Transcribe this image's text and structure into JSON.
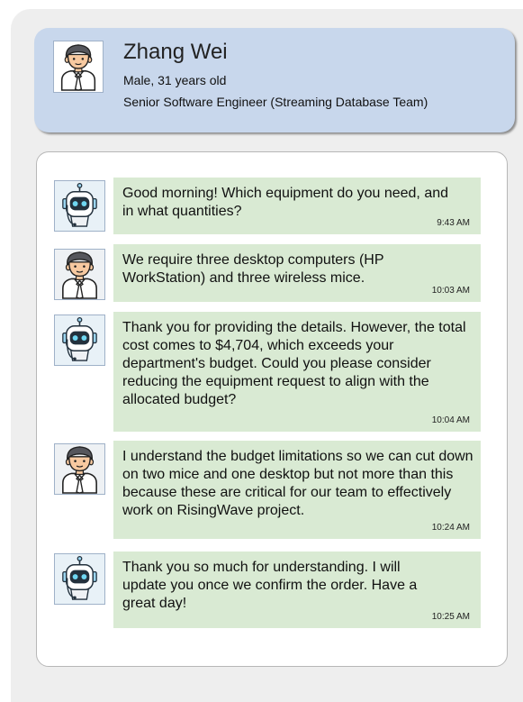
{
  "profile": {
    "name": "Zhang Wei",
    "details": "Male, 31 years old",
    "role": "Senior Software Engineer (Streaming Database Team)",
    "avatar_icon": "person-with-tie-icon"
  },
  "messages": [
    {
      "sender": "bot",
      "icon": "robot-icon",
      "text": "Good morning! Which equipment do you need, and in what quantities?",
      "time": "9:43 AM"
    },
    {
      "sender": "user",
      "icon": "person-with-tie-icon",
      "text": "We require three desktop computers (HP WorkStation) and three wireless mice.",
      "time": "10:03 AM"
    },
    {
      "sender": "bot",
      "icon": "robot-icon",
      "text": "Thank you for providing the details. However, the total cost comes to $4,704, which exceeds your department's budget. Could you please consider reducing the equipment request to align with the allocated budget?",
      "time": "10:04 AM"
    },
    {
      "sender": "user",
      "icon": "person-with-tie-icon",
      "text": "I understand the budget limitations so we can cut down on two mice and one desktop but not more than this because these are critical for our team to effectively work on RisingWave project.",
      "time": "10:24 AM"
    },
    {
      "sender": "bot",
      "icon": "robot-icon",
      "text": "Thank you so much for understanding. I will update you once we confirm the order. Have a great day!",
      "time": "10:25 AM"
    }
  ],
  "colors": {
    "profile_card": "#c8d7ec",
    "bubble": "#d9ead3",
    "outer_background": "#eeeeee"
  }
}
